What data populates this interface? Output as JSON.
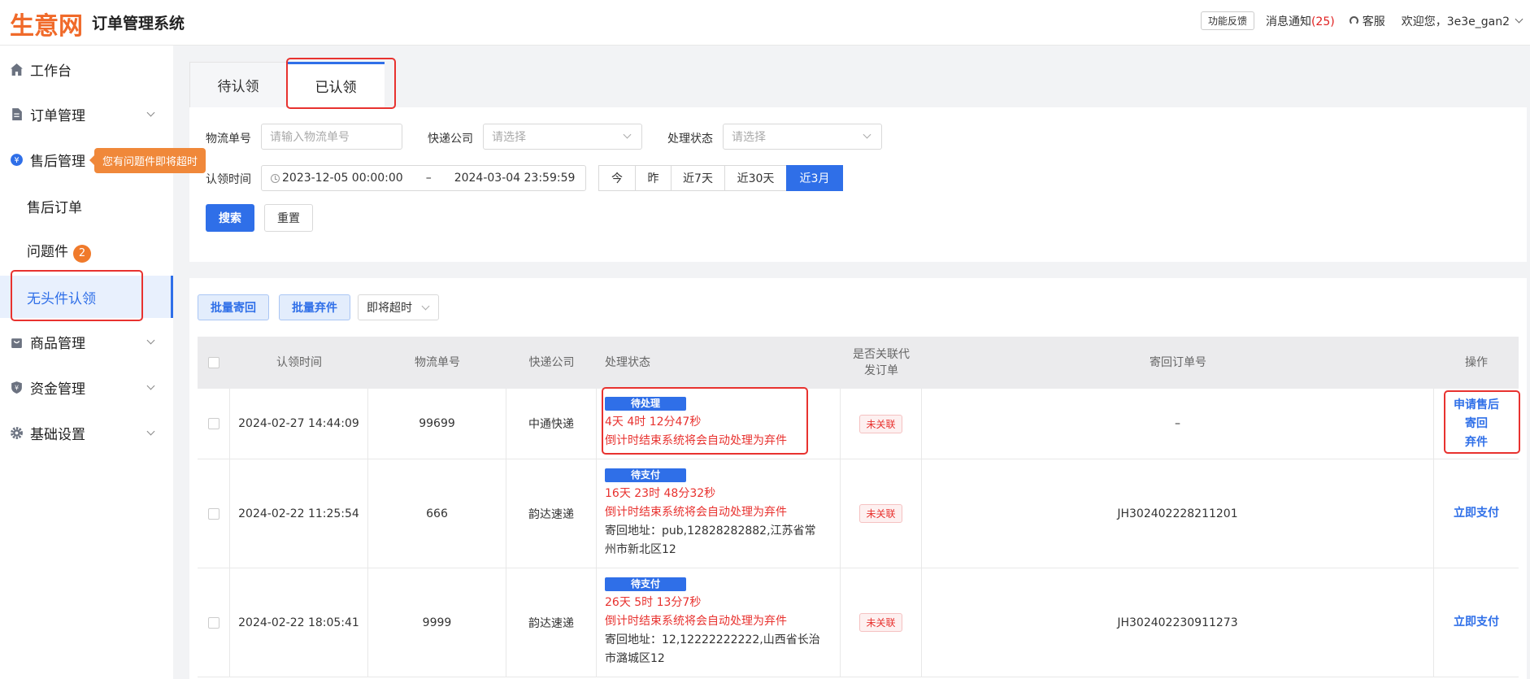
{
  "header": {
    "logo": "生意网",
    "title": "订单管理系统",
    "feedback": "功能反馈",
    "messages_label": "消息通知",
    "messages_count": "(25)",
    "service": "客服",
    "welcome": "欢迎您，3e3e_gan2"
  },
  "sidebar": {
    "items": [
      {
        "label": "工作台",
        "icon": "home-icon"
      },
      {
        "label": "订单管理",
        "icon": "document-icon"
      },
      {
        "label": "售后管理",
        "icon": "yen-icon"
      },
      {
        "label": "商品管理",
        "icon": "bag-icon"
      },
      {
        "label": "资金管理",
        "icon": "shield-yen-icon"
      },
      {
        "label": "基础设置",
        "icon": "gear-icon"
      }
    ],
    "sub_items": [
      {
        "label": "售后订单"
      },
      {
        "label": "问题件",
        "badge": "2"
      },
      {
        "label": "无头件认领"
      }
    ],
    "tooltip": "您有问题件即将超时"
  },
  "tabs": [
    "待认领",
    "已认领"
  ],
  "filters": {
    "tracking_label": "物流单号",
    "tracking_placeholder": "请输入物流单号",
    "courier_label": "快递公司",
    "courier_placeholder": "请选择",
    "status_label": "处理状态",
    "status_placeholder": "请选择",
    "claim_time_label": "认领时间",
    "date_start": "2023-12-05 00:00:00",
    "date_sep": "–",
    "date_end": "2024-03-04 23:59:59",
    "quick": [
      "今",
      "昨",
      "近7天",
      "近30天",
      "近3月"
    ],
    "quick_active": "近3月",
    "search": "搜索",
    "reset": "重置"
  },
  "actions": {
    "batch_return": "批量寄回",
    "batch_abandon": "批量弃件",
    "timeout_select": "即将超时"
  },
  "table": {
    "headers": [
      "认领时间",
      "物流单号",
      "快递公司",
      "处理状态",
      "是否关联代发订单",
      "寄回订单号",
      "操作"
    ],
    "header_linked_1": "是否关联代",
    "header_linked_2": "发订单",
    "rows": [
      {
        "claim_time": "2024-02-27 14:44:09",
        "tracking": "99699",
        "courier": "中通快递",
        "status_tag": "待处理",
        "countdown": "4天 4时 12分47秒",
        "notice": "倒计时结束系统将会自动处理为弃件",
        "address": "",
        "linked": "未关联",
        "return_order": "–",
        "ops": [
          "申请售后",
          "寄回",
          "弃件"
        ]
      },
      {
        "claim_time": "2024-02-22 11:25:54",
        "tracking": "666",
        "courier": "韵达速递",
        "status_tag": "待支付",
        "countdown": "16天 23时 48分32秒",
        "notice": "倒计时结束系统将会自动处理为弃件",
        "address": "寄回地址：pub,12828282882,江苏省常州市新北区12",
        "linked": "未关联",
        "return_order": "JH302402228211201",
        "ops": [
          "立即支付"
        ]
      },
      {
        "claim_time": "2024-02-22 18:05:41",
        "tracking": "9999",
        "courier": "韵达速递",
        "status_tag": "待支付",
        "countdown": "26天 5时 13分7秒",
        "notice": "倒计时结束系统将会自动处理为弃件",
        "address": "寄回地址：12,12222222222,山西省长治市潞城区12",
        "linked": "未关联",
        "return_order": "JH302402230911273",
        "ops": [
          "立即支付"
        ]
      }
    ]
  },
  "colors": {
    "primary": "#2f6fe8",
    "brand": "#f06a2a",
    "danger": "#e8322f",
    "highlight_box": "#e8322f"
  }
}
